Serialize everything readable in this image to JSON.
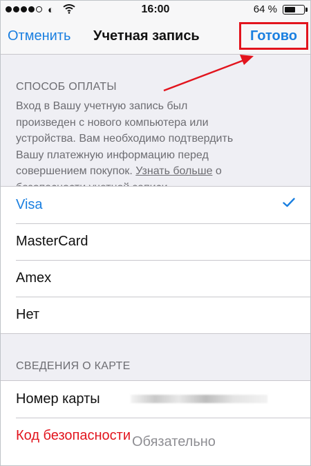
{
  "status_bar": {
    "carrier_icon": "carrier-logo-icon",
    "wifi_icon": "wifi-icon",
    "time": "16:00",
    "battery_percent": "64 %",
    "battery_level": 0.64
  },
  "nav": {
    "cancel_label": "Отменить",
    "title": "Учетная запись",
    "done_label": "Готово",
    "highlight_color": "#e2141d"
  },
  "payment_section": {
    "header": "СПОСОБ ОПЛАТЫ",
    "note_lines": [
      "Вход в Вашу учетную запись был",
      "произведен с нового компьютера или",
      "устройства. Вам необходимо подтвердить",
      "Вашу платежную информацию перед",
      "совершением покупок."
    ],
    "note_link": "Узнать больше",
    "note_after_link": " о",
    "note_last_line": "безопасности учетной записи.",
    "options": [
      {
        "label": "Visa",
        "selected": true
      },
      {
        "label": "MasterCard",
        "selected": false
      },
      {
        "label": "Amex",
        "selected": false
      },
      {
        "label": "Нет",
        "selected": false
      }
    ],
    "check_icon": "checkmark-icon"
  },
  "card_section": {
    "header": "СВЕДЕНИЯ О КАРТЕ",
    "card_number_label": "Номер карты",
    "security_code_label": "Код безопасности",
    "security_code_placeholder": "Обязательно"
  },
  "colors": {
    "accent": "#1a7fe0",
    "warning": "#e2141d",
    "secondary_text": "#6d6d72",
    "background": "#efeff4"
  }
}
